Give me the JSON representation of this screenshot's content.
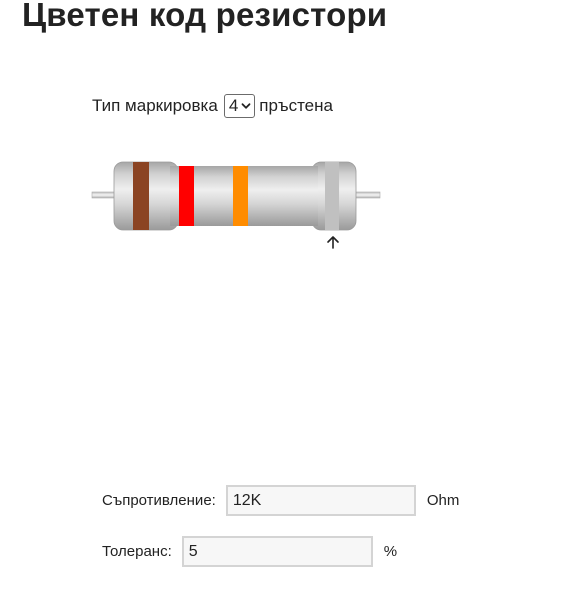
{
  "title": "Цветен код резистори",
  "marking": {
    "label_before": "Тип маркировка",
    "selected": "4",
    "label_after": "пръстена"
  },
  "resistor": {
    "bands": [
      {
        "name": "band-1",
        "color": "#8b4423"
      },
      {
        "name": "band-2",
        "color": "#ff0000"
      },
      {
        "name": "band-3",
        "color": "#ff8c00"
      },
      {
        "name": "tolerance-band",
        "color": "#c0c0c0"
      }
    ],
    "selected_band_marker_icon": "arrow-up-icon"
  },
  "form": {
    "resistance_label": "Съпротивление:",
    "resistance_value": "12K",
    "resistance_unit": "Ohm",
    "tolerance_label": "Толеранс:",
    "tolerance_value": "5",
    "tolerance_unit": "%"
  }
}
